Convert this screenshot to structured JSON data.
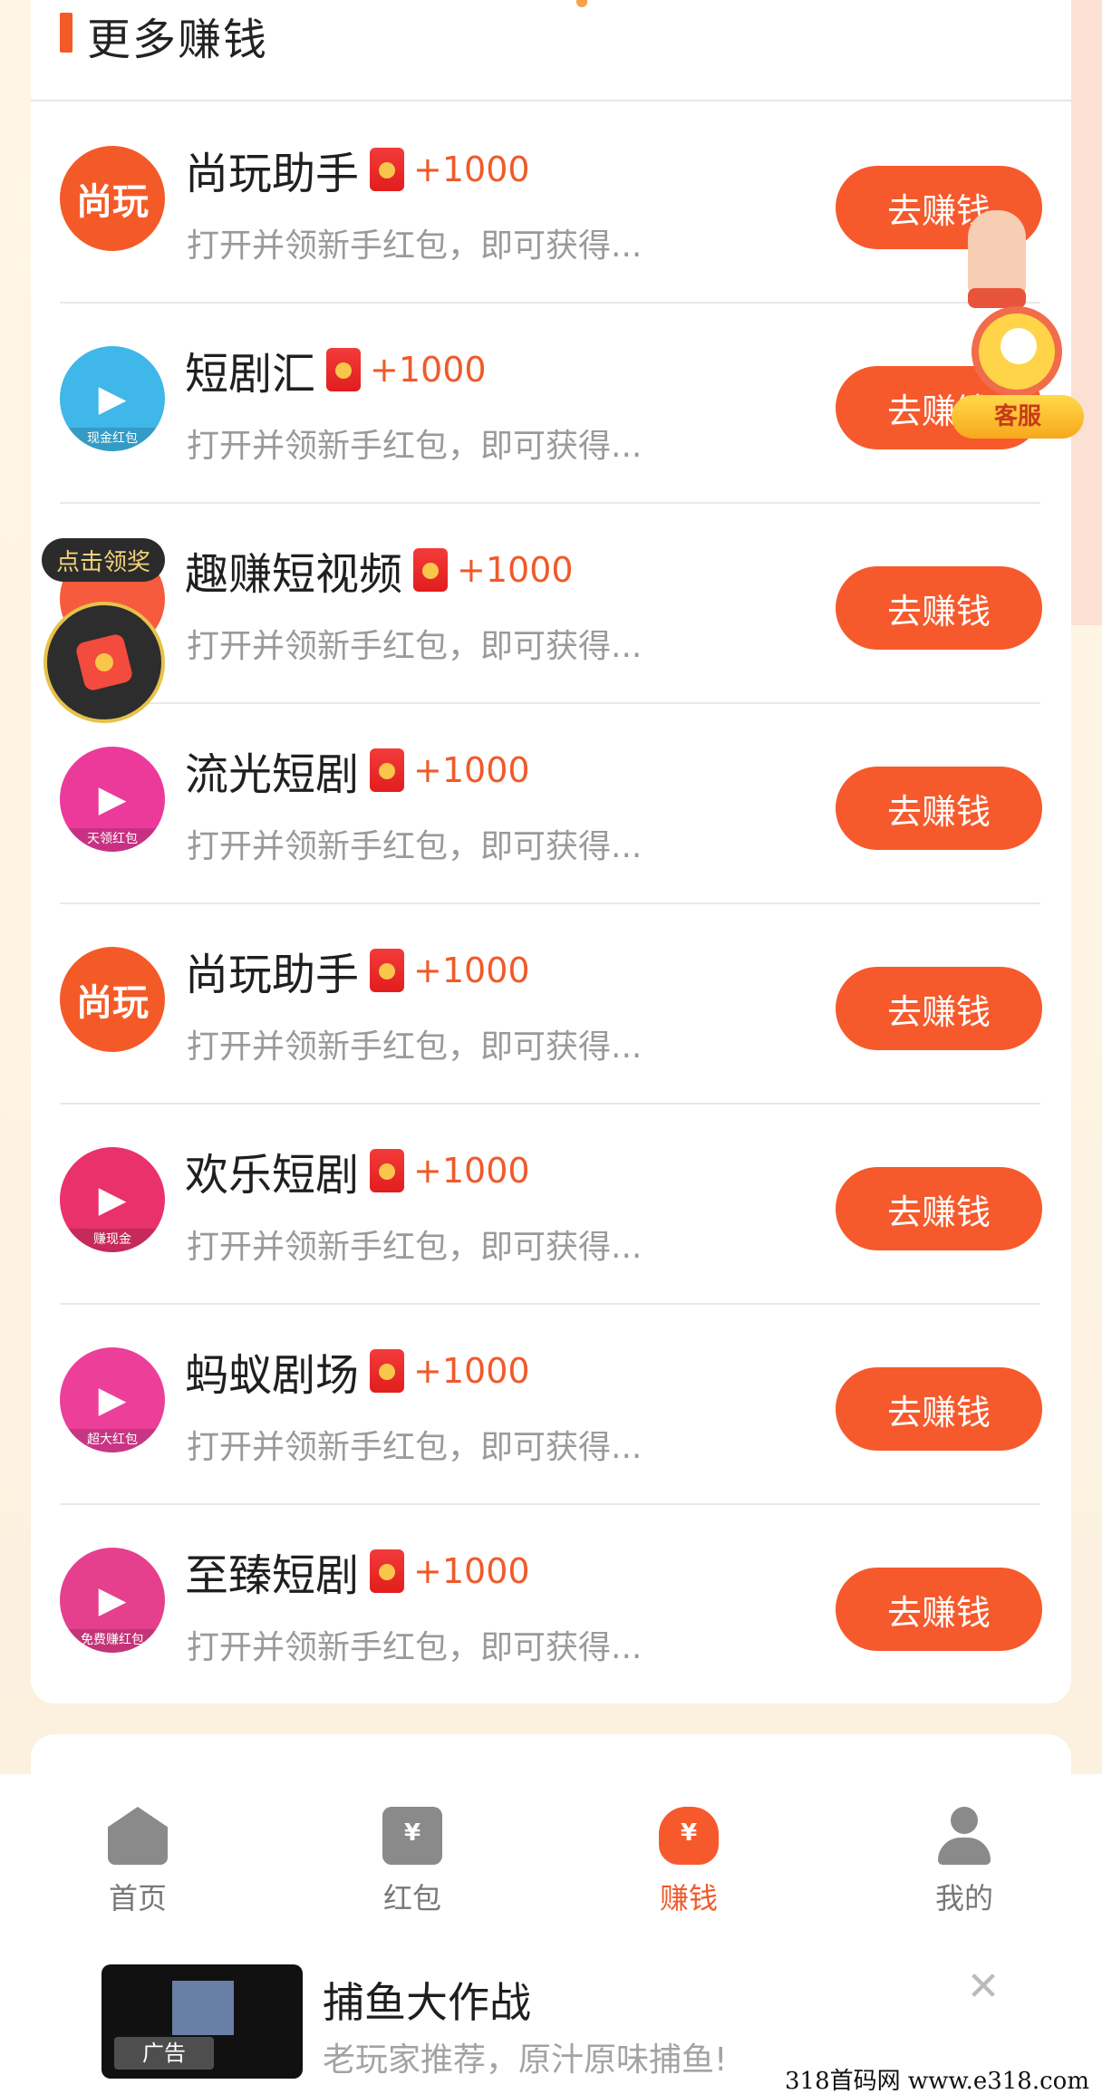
{
  "section": {
    "title": "更多赚钱"
  },
  "apps": [
    {
      "name": "尚玩助手",
      "reward": "+1000",
      "desc": "打开并领新手红包，即可获得...",
      "button": "去赚钱",
      "icon": "shangwan-icon",
      "icon_text": "尚玩",
      "icon_color": "#f45a28",
      "band": ""
    },
    {
      "name": "短剧汇",
      "reward": "+1000",
      "desc": "打开并领新手红包，即可获得...",
      "button": "去赚钱",
      "icon": "duanjuhui-icon",
      "icon_text": "▶",
      "icon_color": "#3fb7e8",
      "band": "现金红包"
    },
    {
      "name": "趣赚短视频",
      "reward": "+1000",
      "desc": "打开并领新手红包，即可获得...",
      "button": "去赚钱",
      "icon": "quzhuan-icon",
      "icon_text": "",
      "icon_color": "#f55b3c",
      "band": ""
    },
    {
      "name": "流光短剧",
      "reward": "+1000",
      "desc": "打开并领新手红包，即可获得...",
      "button": "去赚钱",
      "icon": "liuguang-icon",
      "icon_text": "▶",
      "icon_color": "#ec3a9a",
      "band": "天领红包"
    },
    {
      "name": "尚玩助手",
      "reward": "+1000",
      "desc": "打开并领新手红包，即可获得...",
      "button": "去赚钱",
      "icon": "shangwan-icon",
      "icon_text": "尚玩",
      "icon_color": "#f45a28",
      "band": ""
    },
    {
      "name": "欢乐短剧",
      "reward": "+1000",
      "desc": "打开并领新手红包，即可获得...",
      "button": "去赚钱",
      "icon": "huanle-icon",
      "icon_text": "▶",
      "icon_color": "#e9316b",
      "band": "赚现金"
    },
    {
      "name": "蚂蚁剧场",
      "reward": "+1000",
      "desc": "打开并领新手红包，即可获得...",
      "button": "去赚钱",
      "icon": "mayi-icon",
      "icon_text": "▶",
      "icon_color": "#ec3f9a",
      "band": "超大红包"
    },
    {
      "name": "至臻短剧",
      "reward": "+1000",
      "desc": "打开并领新手红包，即可获得...",
      "button": "去赚钱",
      "icon": "zhizhen-icon",
      "icon_text": "▶",
      "icon_color": "#e63f8e",
      "band": "免费赚红包"
    }
  ],
  "floating": {
    "service_label": "客服",
    "reward_tip": "点击领奖"
  },
  "tabs": [
    {
      "label": "首页",
      "icon": "home-icon",
      "active": false
    },
    {
      "label": "红包",
      "icon": "red-packet-icon",
      "active": false
    },
    {
      "label": "赚钱",
      "icon": "money-bag-icon",
      "active": true
    },
    {
      "label": "我的",
      "icon": "user-icon",
      "active": false
    }
  ],
  "ad": {
    "title": "捕鱼大作战",
    "subtitle": "老玩家推荐，原汁原味捕鱼!",
    "tag": "广告",
    "close": "✕"
  },
  "watermark": "318首码网 www.e318.com",
  "colors": {
    "accent": "#f65a2c",
    "reward": "#f05a2a"
  }
}
